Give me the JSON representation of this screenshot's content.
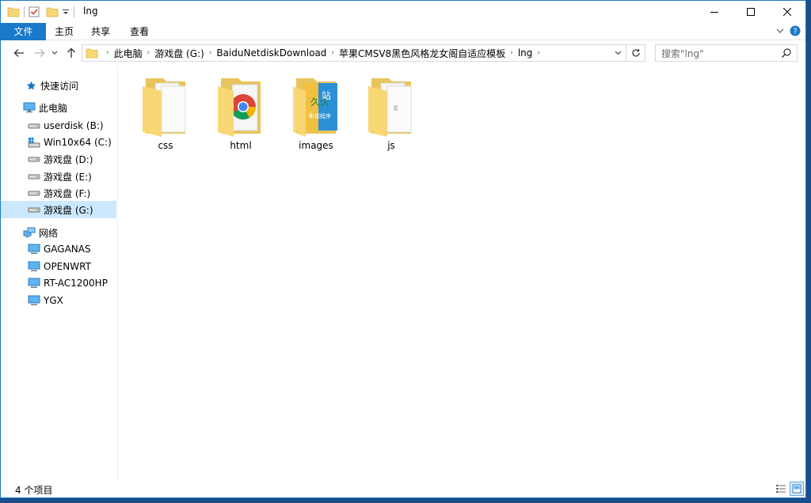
{
  "window": {
    "title": "lng",
    "controls": {
      "minimize": "—",
      "maximize": "☐",
      "close": "✕"
    }
  },
  "ribbon": {
    "tabs": [
      {
        "label": "文件",
        "active": true
      },
      {
        "label": "主页",
        "active": false
      },
      {
        "label": "共享",
        "active": false
      },
      {
        "label": "查看",
        "active": false
      }
    ]
  },
  "address_bar": {
    "breadcrumbs": [
      "此电脑",
      "游戏盘 (G:)",
      "BaiduNetdiskDownload",
      "苹果CMSV8黑色风格龙女阁自适应模板",
      "lng"
    ],
    "search_placeholder": "搜索\"lng\""
  },
  "sidebar": {
    "quick_access": "快速访问",
    "this_pc": "此电脑",
    "drives": [
      {
        "label": "userdisk (B:)",
        "selected": false
      },
      {
        "label": "Win10x64 (C:)",
        "selected": false
      },
      {
        "label": "游戏盘 (D:)",
        "selected": false
      },
      {
        "label": "游戏盘 (E:)",
        "selected": false
      },
      {
        "label": "游戏盘 (F:)",
        "selected": false
      },
      {
        "label": "游戏盘 (G:)",
        "selected": true
      }
    ],
    "network": "网络",
    "computers": [
      "GAGANAS",
      "OPENWRT",
      "RT-AC1200HP",
      "YGX"
    ]
  },
  "files": [
    {
      "name": "css",
      "icon": "folder-icon"
    },
    {
      "name": "html",
      "icon": "folder-chrome-icon"
    },
    {
      "name": "images",
      "icon": "folder-image-icon"
    },
    {
      "name": "js",
      "icon": "folder-icon"
    }
  ],
  "thumbnail_text": {
    "line1": "久久",
    "line2": "站",
    "line3": "影视程序"
  },
  "status": {
    "item_count": "4 个项目"
  },
  "colors": {
    "accent": "#1979ca",
    "selected": "#cce8ff",
    "folder": "#f8d775"
  }
}
